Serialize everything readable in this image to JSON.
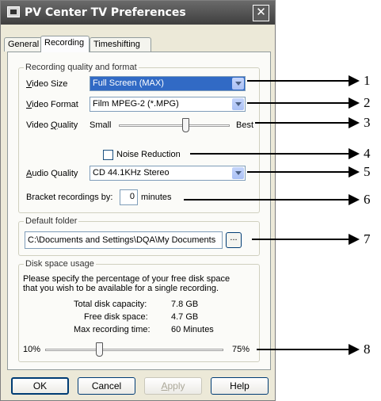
{
  "window": {
    "title": "PV Center TV Preferences",
    "close_label": "✕",
    "app_icon": "tv-icon"
  },
  "tabs": [
    {
      "label": "General"
    },
    {
      "label": "Recording",
      "active": true
    },
    {
      "label": "Timeshifting"
    }
  ],
  "recording_group": {
    "title": "Recording quality and format",
    "video_size": {
      "label_u": "V",
      "label_rest": "ideo Size",
      "value": "Full Screen (MAX)"
    },
    "video_format": {
      "label_u": "V",
      "label_rest": "ideo Format",
      "value": "Film MPEG-2 (*.MPG)"
    },
    "video_quality": {
      "label_pre": "Video ",
      "label_u": "Q",
      "label_rest": "uality",
      "min_label": "Small",
      "max_label": "Best",
      "level": 0.6
    },
    "noise_reduction": {
      "label": "Noise Reduction",
      "checked": false
    },
    "audio_quality": {
      "label_u": "A",
      "label_rest": "udio Quality",
      "value": "CD 44.1KHz Stereo"
    },
    "bracket": {
      "label": "Bracket recordings by:",
      "value": "0",
      "unit": "minutes"
    }
  },
  "folder_group": {
    "title": "Default folder",
    "path": "C:\\Documents and Settings\\DQA\\My Documents",
    "browse_label": "..."
  },
  "disk_group": {
    "title": "Disk space usage",
    "description_line1": "Please specify the percentage of your free disk space",
    "description_line2": "that you wish to be available for a single recording.",
    "stats": [
      {
        "label": "Total disk capacity:",
        "value": "7.8 GB"
      },
      {
        "label": "Free disk space:",
        "value": "4.7 GB"
      },
      {
        "label": "Max recording time:",
        "value": "60 Minutes"
      }
    ],
    "slider": {
      "min_label": "10%",
      "max_label": "75%",
      "level": 0.3
    }
  },
  "buttons": {
    "ok": "OK",
    "cancel": "Cancel",
    "apply_u": "A",
    "apply_rest": "pply",
    "help": "Help"
  },
  "annotations": [
    "1",
    "2",
    "3",
    "4",
    "5",
    "6",
    "7",
    "8"
  ]
}
